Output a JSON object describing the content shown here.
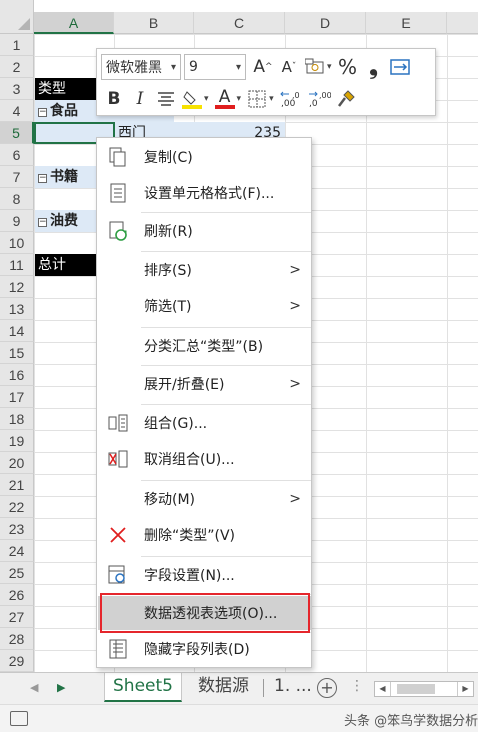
{
  "columns": [
    "A",
    "B",
    "C",
    "D",
    "E"
  ],
  "rows": [
    "1",
    "2",
    "3",
    "4",
    "5",
    "6",
    "7",
    "8",
    "9",
    "10",
    "11",
    "12",
    "13",
    "14",
    "15",
    "16",
    "17",
    "18",
    "19",
    "20",
    "21",
    "22",
    "23",
    "24",
    "25",
    "26",
    "27",
    "28",
    "29"
  ],
  "cells": {
    "a3": "类型",
    "a4": "食品",
    "b5": "西门",
    "c5": "235",
    "a7": "书籍",
    "a9": "油费",
    "a11": "总计"
  },
  "mini_toolbar": {
    "font_name": "微软雅黑",
    "font_size": "9",
    "bold": "B",
    "italic": "I",
    "increase_font": "A",
    "decrease_font": "A",
    "font_color_letter": "A",
    "percent": "%",
    "comma": "❟",
    "highlight_color": "#f7e200",
    "font_color": "#e01e1e"
  },
  "context_menu": [
    {
      "label": "复制(C)",
      "icon": "copy-icon",
      "submenu": false
    },
    {
      "label": "设置单元格格式(F)...",
      "icon": "format-cells-icon",
      "submenu": false
    },
    {
      "label": "刷新(R)",
      "icon": "refresh-icon",
      "submenu": false
    },
    {
      "label": "排序(S)",
      "icon": "",
      "submenu": true
    },
    {
      "label": "筛选(T)",
      "icon": "",
      "submenu": true
    },
    {
      "label": "分类汇总“类型”(B)",
      "icon": "",
      "submenu": false
    },
    {
      "label": "展开/折叠(E)",
      "icon": "",
      "submenu": true
    },
    {
      "label": "组合(G)...",
      "icon": "group-icon",
      "submenu": false
    },
    {
      "label": "取消组合(U)...",
      "icon": "ungroup-icon",
      "submenu": false
    },
    {
      "label": "移动(M)",
      "icon": "",
      "submenu": true
    },
    {
      "label": "删除“类型”(V)",
      "icon": "delete-icon",
      "submenu": false
    },
    {
      "label": "字段设置(N)...",
      "icon": "field-settings-icon",
      "submenu": false
    },
    {
      "label": "数据透视表选项(O)...",
      "icon": "",
      "submenu": false,
      "highlighted": true
    },
    {
      "label": "隐藏字段列表(D)",
      "icon": "field-list-icon",
      "submenu": false
    }
  ],
  "sheet_tabs": {
    "active": "Sheet5",
    "second": "数据源",
    "more": "1. ..."
  },
  "status": {
    "watermark": "头条 @笨鸟学数据分析"
  },
  "colors": {
    "accent": "#217346",
    "highlight_border": "#e5262c",
    "pivot_header_bg": "#000000",
    "pivot_row_bg": "#dde9f6"
  }
}
